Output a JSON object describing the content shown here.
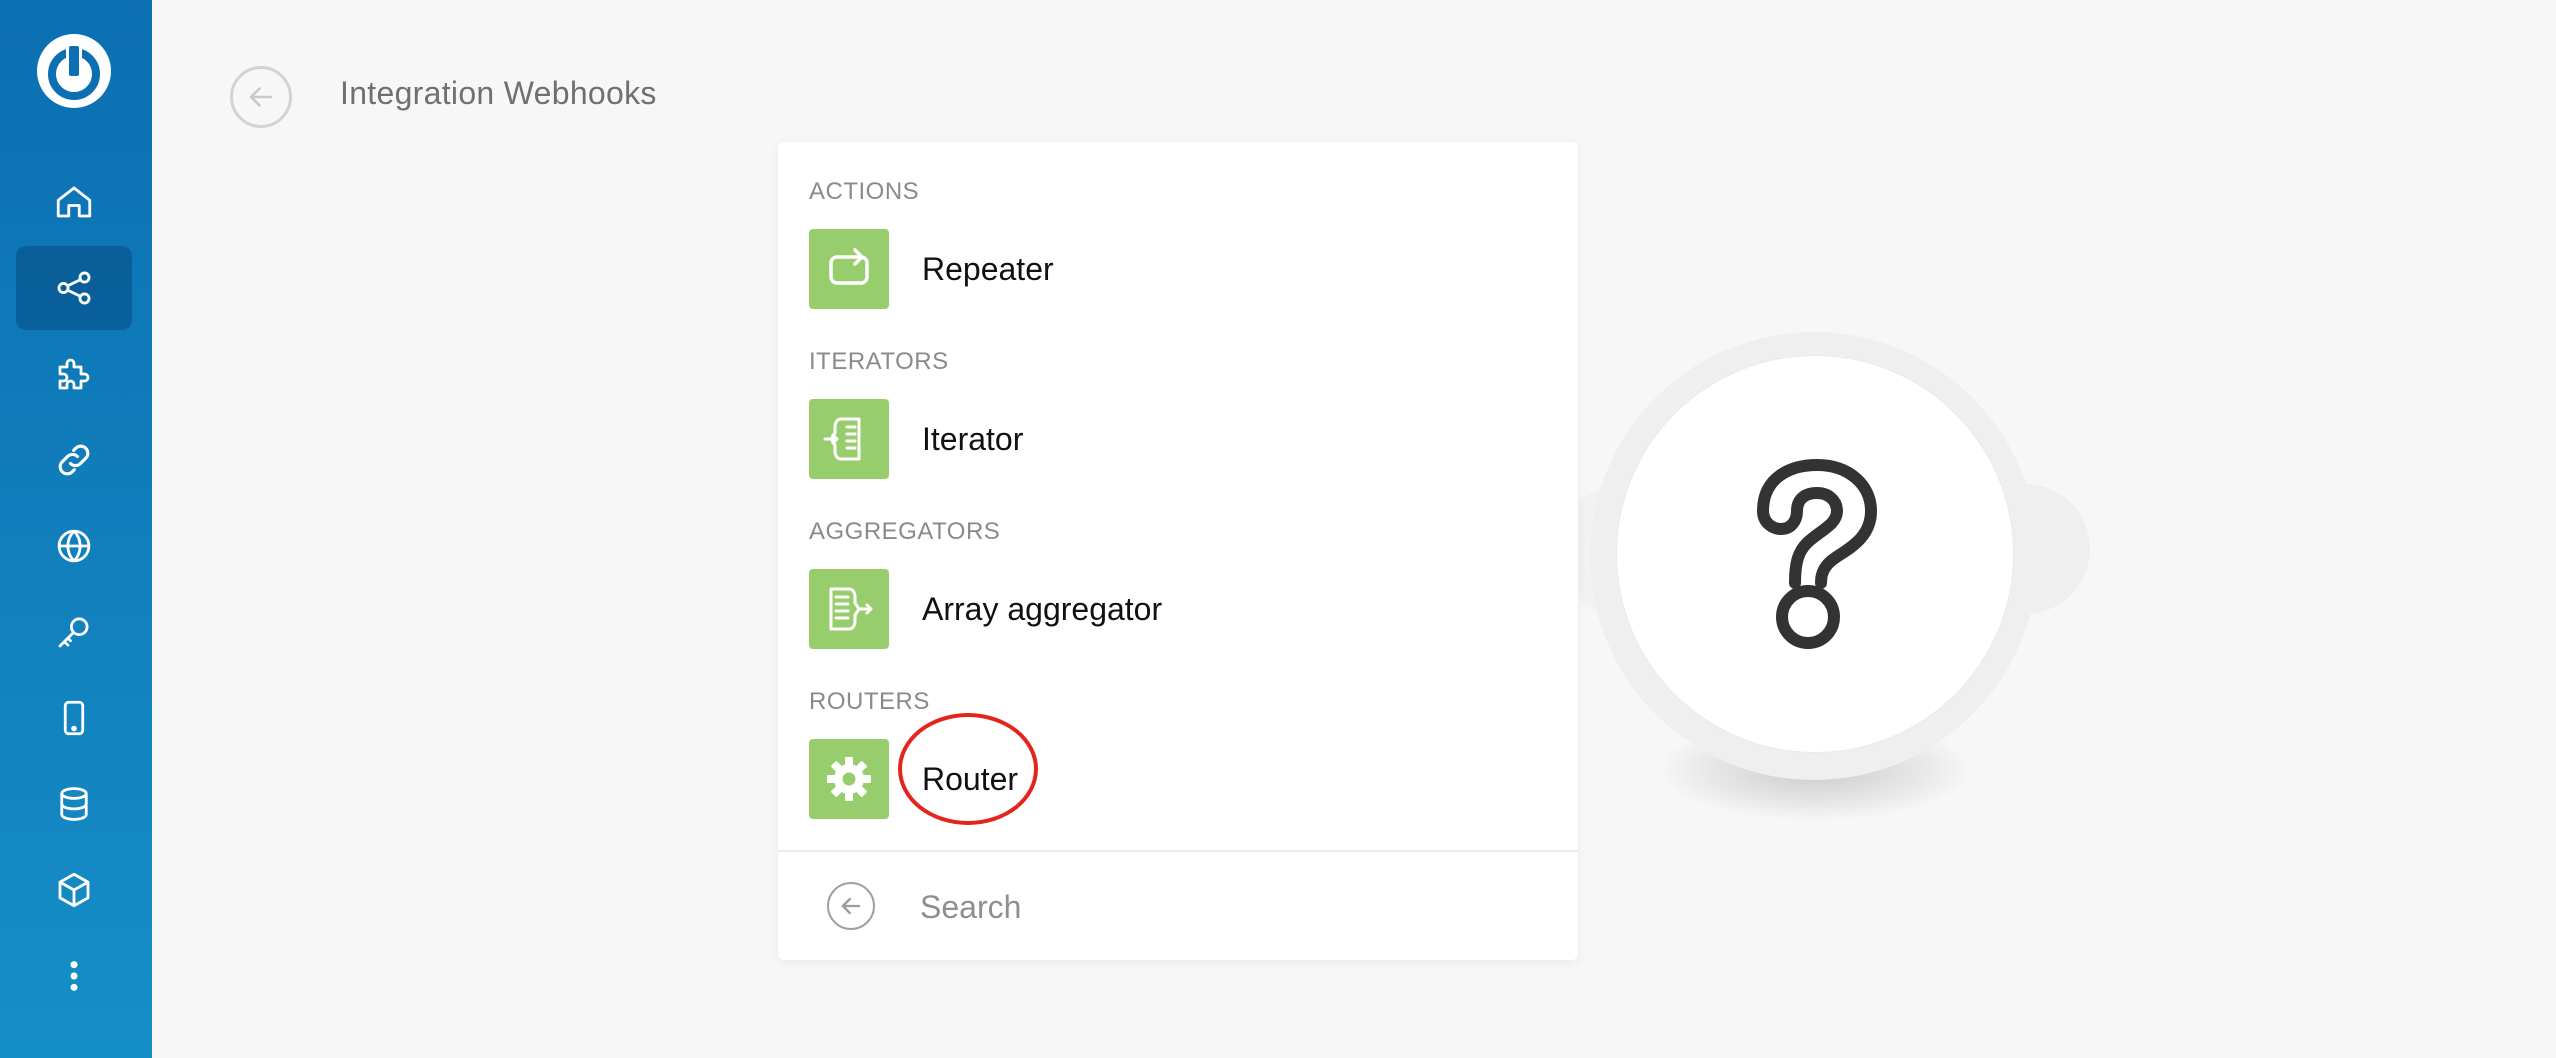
{
  "colors": {
    "sidebar_top": "#0b6fb2",
    "sidebar_bottom": "#168ec6",
    "tile_green": "#98cd6e",
    "highlight_red": "#e2261d"
  },
  "sidebar": {
    "logo_icon": "power-logo-icon",
    "items": [
      {
        "icon": "home-icon",
        "active": false
      },
      {
        "icon": "share-icon",
        "active": true
      },
      {
        "icon": "puzzle-icon",
        "active": false
      },
      {
        "icon": "link-icon",
        "active": false
      },
      {
        "icon": "globe-icon",
        "active": false
      },
      {
        "icon": "key-icon",
        "active": false
      },
      {
        "icon": "mobile-icon",
        "active": false
      },
      {
        "icon": "database-icon",
        "active": false
      },
      {
        "icon": "cube-icon",
        "active": false
      },
      {
        "icon": "more-vertical-icon",
        "active": false
      }
    ]
  },
  "header": {
    "title": "Integration Webhooks",
    "back_icon": "arrow-left-circle-icon"
  },
  "menu": {
    "sections": [
      {
        "label": "ACTIONS",
        "items": [
          {
            "label": "Repeater",
            "icon": "repeat-icon"
          }
        ]
      },
      {
        "label": "ITERATORS",
        "items": [
          {
            "label": "Iterator",
            "icon": "iterator-icon"
          }
        ]
      },
      {
        "label": "AGGREGATORS",
        "items": [
          {
            "label": "Array aggregator",
            "icon": "aggregator-icon"
          }
        ]
      },
      {
        "label": "ROUTERS",
        "items": [
          {
            "label": "Router",
            "icon": "gear-icon",
            "highlighted": true
          }
        ]
      }
    ],
    "search": {
      "placeholder": "Search",
      "value": ""
    }
  },
  "module": {
    "icon": "question-mark-icon"
  }
}
